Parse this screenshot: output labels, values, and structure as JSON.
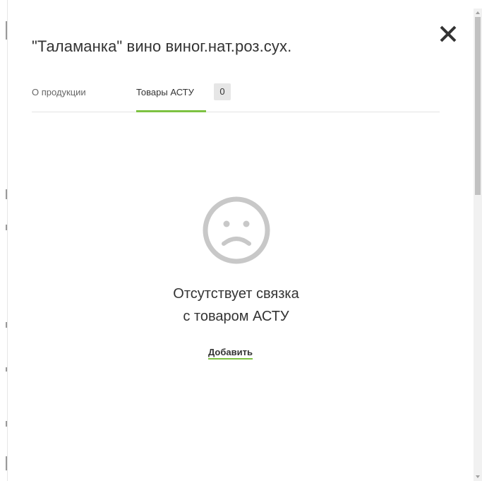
{
  "dialog": {
    "title": "\"Таламанка\" вино виног.нат.роз.сух.",
    "close_icon": "close-icon"
  },
  "tabs": [
    {
      "label": "О продукции",
      "active": false
    },
    {
      "label": "Товары АСТУ",
      "badge": "0",
      "active": true
    }
  ],
  "empty_state": {
    "icon": "sad-face-icon",
    "message_line1": "Отсутствует связка",
    "message_line2": "с товаром АСТУ",
    "add_label": "Добавить"
  },
  "colors": {
    "accent": "#7dc242",
    "text": "#333333",
    "muted_text": "#666666",
    "icon_gray": "#c8c8c8",
    "badge_bg": "#e6e6e6"
  }
}
